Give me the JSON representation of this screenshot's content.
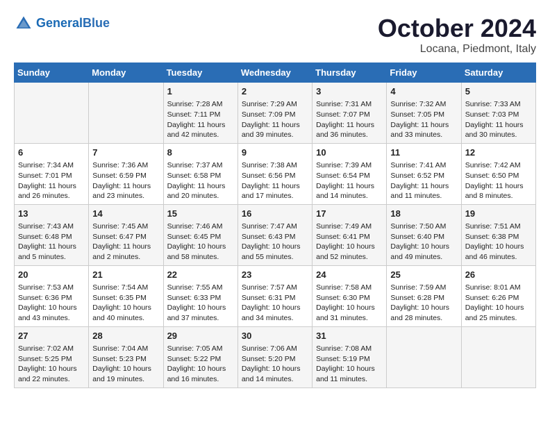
{
  "header": {
    "logo_line1": "General",
    "logo_line2": "Blue",
    "month": "October 2024",
    "location": "Locana, Piedmont, Italy"
  },
  "weekdays": [
    "Sunday",
    "Monday",
    "Tuesday",
    "Wednesday",
    "Thursday",
    "Friday",
    "Saturday"
  ],
  "weeks": [
    [
      {
        "day": "",
        "sunrise": "",
        "sunset": "",
        "daylight": ""
      },
      {
        "day": "",
        "sunrise": "",
        "sunset": "",
        "daylight": ""
      },
      {
        "day": "1",
        "sunrise": "Sunrise: 7:28 AM",
        "sunset": "Sunset: 7:11 PM",
        "daylight": "Daylight: 11 hours and 42 minutes."
      },
      {
        "day": "2",
        "sunrise": "Sunrise: 7:29 AM",
        "sunset": "Sunset: 7:09 PM",
        "daylight": "Daylight: 11 hours and 39 minutes."
      },
      {
        "day": "3",
        "sunrise": "Sunrise: 7:31 AM",
        "sunset": "Sunset: 7:07 PM",
        "daylight": "Daylight: 11 hours and 36 minutes."
      },
      {
        "day": "4",
        "sunrise": "Sunrise: 7:32 AM",
        "sunset": "Sunset: 7:05 PM",
        "daylight": "Daylight: 11 hours and 33 minutes."
      },
      {
        "day": "5",
        "sunrise": "Sunrise: 7:33 AM",
        "sunset": "Sunset: 7:03 PM",
        "daylight": "Daylight: 11 hours and 30 minutes."
      }
    ],
    [
      {
        "day": "6",
        "sunrise": "Sunrise: 7:34 AM",
        "sunset": "Sunset: 7:01 PM",
        "daylight": "Daylight: 11 hours and 26 minutes."
      },
      {
        "day": "7",
        "sunrise": "Sunrise: 7:36 AM",
        "sunset": "Sunset: 6:59 PM",
        "daylight": "Daylight: 11 hours and 23 minutes."
      },
      {
        "day": "8",
        "sunrise": "Sunrise: 7:37 AM",
        "sunset": "Sunset: 6:58 PM",
        "daylight": "Daylight: 11 hours and 20 minutes."
      },
      {
        "day": "9",
        "sunrise": "Sunrise: 7:38 AM",
        "sunset": "Sunset: 6:56 PM",
        "daylight": "Daylight: 11 hours and 17 minutes."
      },
      {
        "day": "10",
        "sunrise": "Sunrise: 7:39 AM",
        "sunset": "Sunset: 6:54 PM",
        "daylight": "Daylight: 11 hours and 14 minutes."
      },
      {
        "day": "11",
        "sunrise": "Sunrise: 7:41 AM",
        "sunset": "Sunset: 6:52 PM",
        "daylight": "Daylight: 11 hours and 11 minutes."
      },
      {
        "day": "12",
        "sunrise": "Sunrise: 7:42 AM",
        "sunset": "Sunset: 6:50 PM",
        "daylight": "Daylight: 11 hours and 8 minutes."
      }
    ],
    [
      {
        "day": "13",
        "sunrise": "Sunrise: 7:43 AM",
        "sunset": "Sunset: 6:48 PM",
        "daylight": "Daylight: 11 hours and 5 minutes."
      },
      {
        "day": "14",
        "sunrise": "Sunrise: 7:45 AM",
        "sunset": "Sunset: 6:47 PM",
        "daylight": "Daylight: 11 hours and 2 minutes."
      },
      {
        "day": "15",
        "sunrise": "Sunrise: 7:46 AM",
        "sunset": "Sunset: 6:45 PM",
        "daylight": "Daylight: 10 hours and 58 minutes."
      },
      {
        "day": "16",
        "sunrise": "Sunrise: 7:47 AM",
        "sunset": "Sunset: 6:43 PM",
        "daylight": "Daylight: 10 hours and 55 minutes."
      },
      {
        "day": "17",
        "sunrise": "Sunrise: 7:49 AM",
        "sunset": "Sunset: 6:41 PM",
        "daylight": "Daylight: 10 hours and 52 minutes."
      },
      {
        "day": "18",
        "sunrise": "Sunrise: 7:50 AM",
        "sunset": "Sunset: 6:40 PM",
        "daylight": "Daylight: 10 hours and 49 minutes."
      },
      {
        "day": "19",
        "sunrise": "Sunrise: 7:51 AM",
        "sunset": "Sunset: 6:38 PM",
        "daylight": "Daylight: 10 hours and 46 minutes."
      }
    ],
    [
      {
        "day": "20",
        "sunrise": "Sunrise: 7:53 AM",
        "sunset": "Sunset: 6:36 PM",
        "daylight": "Daylight: 10 hours and 43 minutes."
      },
      {
        "day": "21",
        "sunrise": "Sunrise: 7:54 AM",
        "sunset": "Sunset: 6:35 PM",
        "daylight": "Daylight: 10 hours and 40 minutes."
      },
      {
        "day": "22",
        "sunrise": "Sunrise: 7:55 AM",
        "sunset": "Sunset: 6:33 PM",
        "daylight": "Daylight: 10 hours and 37 minutes."
      },
      {
        "day": "23",
        "sunrise": "Sunrise: 7:57 AM",
        "sunset": "Sunset: 6:31 PM",
        "daylight": "Daylight: 10 hours and 34 minutes."
      },
      {
        "day": "24",
        "sunrise": "Sunrise: 7:58 AM",
        "sunset": "Sunset: 6:30 PM",
        "daylight": "Daylight: 10 hours and 31 minutes."
      },
      {
        "day": "25",
        "sunrise": "Sunrise: 7:59 AM",
        "sunset": "Sunset: 6:28 PM",
        "daylight": "Daylight: 10 hours and 28 minutes."
      },
      {
        "day": "26",
        "sunrise": "Sunrise: 8:01 AM",
        "sunset": "Sunset: 6:26 PM",
        "daylight": "Daylight: 10 hours and 25 minutes."
      }
    ],
    [
      {
        "day": "27",
        "sunrise": "Sunrise: 7:02 AM",
        "sunset": "Sunset: 5:25 PM",
        "daylight": "Daylight: 10 hours and 22 minutes."
      },
      {
        "day": "28",
        "sunrise": "Sunrise: 7:04 AM",
        "sunset": "Sunset: 5:23 PM",
        "daylight": "Daylight: 10 hours and 19 minutes."
      },
      {
        "day": "29",
        "sunrise": "Sunrise: 7:05 AM",
        "sunset": "Sunset: 5:22 PM",
        "daylight": "Daylight: 10 hours and 16 minutes."
      },
      {
        "day": "30",
        "sunrise": "Sunrise: 7:06 AM",
        "sunset": "Sunset: 5:20 PM",
        "daylight": "Daylight: 10 hours and 14 minutes."
      },
      {
        "day": "31",
        "sunrise": "Sunrise: 7:08 AM",
        "sunset": "Sunset: 5:19 PM",
        "daylight": "Daylight: 10 hours and 11 minutes."
      },
      {
        "day": "",
        "sunrise": "",
        "sunset": "",
        "daylight": ""
      },
      {
        "day": "",
        "sunrise": "",
        "sunset": "",
        "daylight": ""
      }
    ]
  ]
}
